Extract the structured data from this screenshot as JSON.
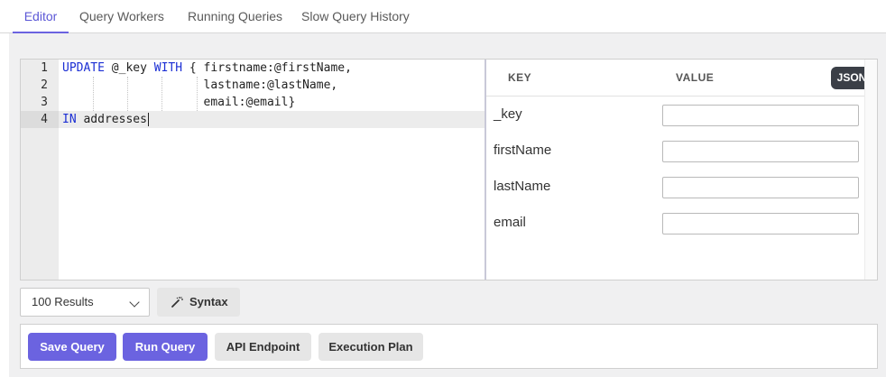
{
  "tabs": [
    {
      "label": "Editor",
      "active": true
    },
    {
      "label": "Query Workers",
      "active": false
    },
    {
      "label": "Running Queries",
      "active": false
    },
    {
      "label": "Slow Query History",
      "active": false
    }
  ],
  "editor": {
    "line_numbers": [
      "1",
      "2",
      "3",
      "4"
    ],
    "lines": [
      [
        {
          "t": "UPDATE",
          "k": true
        },
        {
          "t": " @_key ",
          "k": false
        },
        {
          "t": "WITH",
          "k": true
        },
        {
          "t": " { firstname:@firstName,",
          "k": false
        }
      ],
      [
        {
          "t": "                    lastname:@lastName,",
          "k": false
        }
      ],
      [
        {
          "t": "                    email:@email}",
          "k": false
        }
      ],
      [
        {
          "t": "IN",
          "k": true
        },
        {
          "t": " addresses",
          "k": false
        }
      ]
    ]
  },
  "params": {
    "key_header": "KEY",
    "value_header": "VALUE",
    "json_label": "JSON",
    "rows": [
      {
        "key": "_key",
        "value": ""
      },
      {
        "key": "firstName",
        "value": ""
      },
      {
        "key": "lastName",
        "value": ""
      },
      {
        "key": "email",
        "value": ""
      }
    ]
  },
  "results_select": {
    "value": "100 Results"
  },
  "syntax_label": "Syntax",
  "actions": {
    "save": "Save Query",
    "run": "Run Query",
    "api": "API Endpoint",
    "plan": "Execution Plan"
  },
  "colors": {
    "accent": "#6b63e0",
    "keyword": "#1c2fd4",
    "json_button": "#3b3f47"
  }
}
